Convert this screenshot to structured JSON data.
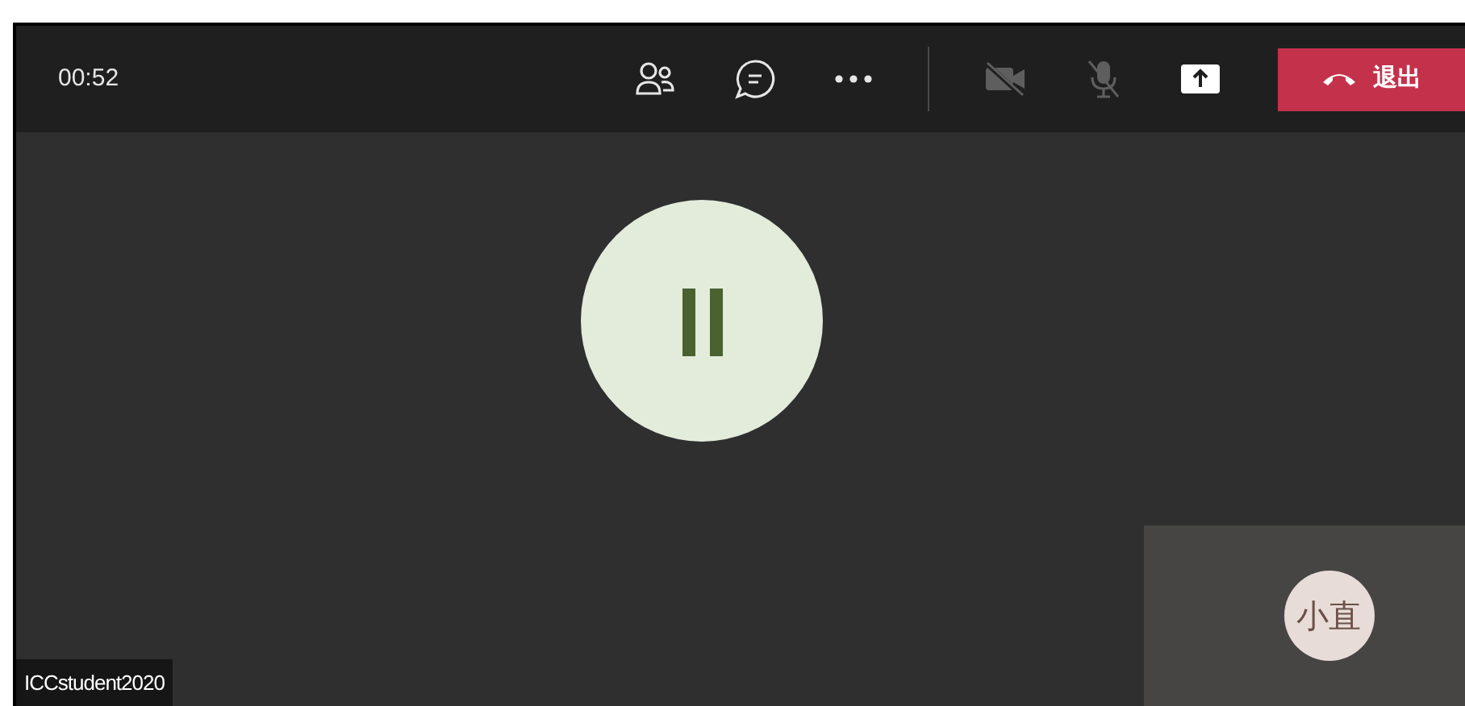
{
  "call_bar": {
    "timer": "00:52",
    "controls": [
      {
        "kind": "people"
      },
      {
        "kind": "chat"
      },
      {
        "kind": "more"
      },
      {
        "kind": "divider"
      },
      {
        "kind": "camera",
        "on": false
      },
      {
        "kind": "mic",
        "on": false
      },
      {
        "kind": "share"
      }
    ],
    "leave_button": {
      "label": "退出"
    }
  },
  "stage": {
    "paused": true,
    "self_tile": {
      "initials": "小直"
    },
    "name_tag": "ICCstudent2020"
  }
}
